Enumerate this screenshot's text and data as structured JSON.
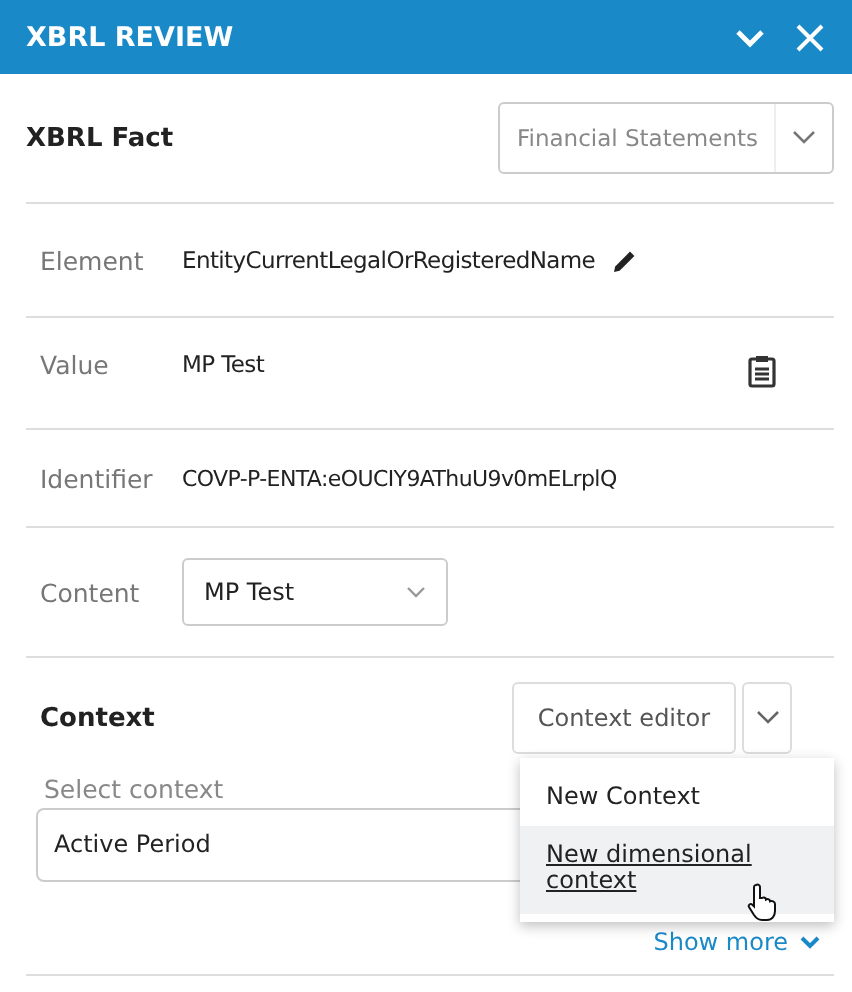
{
  "header": {
    "title": "XBRL REVIEW"
  },
  "fact": {
    "title": "XBRL Fact",
    "dropdown": {
      "value": "Financial Statements"
    }
  },
  "fields": [
    {
      "kind": "edit",
      "label": "Element",
      "value": "EntityCurrentLegalOrRegisteredName"
    },
    {
      "kind": "clipboard",
      "label": "Value",
      "value": "MP Test"
    },
    {
      "kind": "text",
      "label": "Identifier",
      "value": "COVP-P-ENTA:eOUCIY9AThuU9v0mELrplQ"
    },
    {
      "kind": "select",
      "label": "Content",
      "value": "MP Test"
    }
  ],
  "context": {
    "title": "Context",
    "editor_button": "Context editor",
    "select_label": "Select context",
    "select_value": "Active Period",
    "show_more": "Show more",
    "menu": [
      {
        "label": "New Context",
        "hovered": false
      },
      {
        "label": "New dimensional context",
        "hovered": true
      }
    ]
  }
}
